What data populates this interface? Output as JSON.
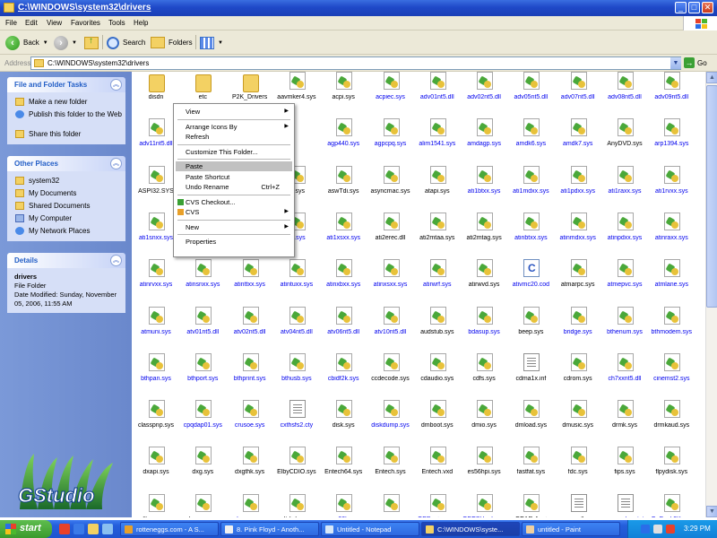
{
  "window": {
    "title": "C:\\WINDOWS\\system32\\drivers"
  },
  "menubar": [
    "File",
    "Edit",
    "View",
    "Favorites",
    "Tools",
    "Help"
  ],
  "toolbar": {
    "back_label": "Back",
    "search_label": "Search",
    "folders_label": "Folders"
  },
  "address": {
    "label": "Address",
    "path": "C:\\WINDOWS\\system32\\drivers",
    "go_label": "Go"
  },
  "taskpane": {
    "file_tasks": {
      "title": "File and Folder Tasks",
      "items": [
        "Make a new folder",
        "Publish this folder to the Web",
        "Share this folder"
      ]
    },
    "other_places": {
      "title": "Other Places",
      "items": [
        "system32",
        "My Documents",
        "Shared Documents",
        "My Computer",
        "My Network Places"
      ]
    },
    "details": {
      "title": "Details",
      "name": "drivers",
      "type": "File Folder",
      "modified": "Date Modified: Sunday, November 05, 2006, 11:55 AM"
    },
    "logo_text": "GStudio"
  },
  "files": [
    {
      "name": "disdn",
      "type": "folder",
      "color": "black"
    },
    {
      "name": "etc",
      "type": "folder",
      "color": "black"
    },
    {
      "name": "P2K_Drivers",
      "type": "folder",
      "color": "black"
    },
    {
      "name": "aavmker4.sys",
      "type": "sys",
      "color": "black"
    },
    {
      "name": "acpi.sys",
      "type": "sys",
      "color": "black"
    },
    {
      "name": "acpiec.sys",
      "type": "sys",
      "color": "blue"
    },
    {
      "name": "adv01nt5.dll",
      "type": "sys",
      "color": "blue"
    },
    {
      "name": "adv02nt5.dll",
      "type": "sys",
      "color": "blue"
    },
    {
      "name": "adv05nt5.dll",
      "type": "sys",
      "color": "blue"
    },
    {
      "name": "adv07nt5.dll",
      "type": "sys",
      "color": "blue"
    },
    {
      "name": "adv08nt5.dll",
      "type": "sys",
      "color": "blue"
    },
    {
      "name": "adv09nt5.dll",
      "type": "sys",
      "color": "blue"
    },
    {
      "name": "adv11nt5.dll",
      "type": "sys",
      "color": "blue"
    },
    {
      "name": "",
      "type": "none",
      "color": "blue"
    },
    {
      "name": "",
      "type": "none",
      "color": "blue"
    },
    {
      "name": "",
      "type": "none",
      "color": "blue"
    },
    {
      "name": "agp440.sys",
      "type": "sys",
      "color": "blue"
    },
    {
      "name": "agpcpq.sys",
      "type": "sys",
      "color": "blue"
    },
    {
      "name": "alim1541.sys",
      "type": "sys",
      "color": "blue"
    },
    {
      "name": "amdagp.sys",
      "type": "sys",
      "color": "blue"
    },
    {
      "name": "amdk6.sys",
      "type": "sys",
      "color": "blue"
    },
    {
      "name": "amdk7.sys",
      "type": "sys",
      "color": "blue"
    },
    {
      "name": "AnyDVD.sys",
      "type": "sys",
      "color": "black"
    },
    {
      "name": "arp1394.sys",
      "type": "sys",
      "color": "blue"
    },
    {
      "name": "ASPI32.SYS",
      "type": "sys",
      "color": "black"
    },
    {
      "name": "",
      "type": "none",
      "color": "black"
    },
    {
      "name": "",
      "type": "none",
      "color": "black"
    },
    {
      "name": "dr.sys",
      "type": "sys",
      "color": "black"
    },
    {
      "name": "aswTdi.sys",
      "type": "sys",
      "color": "black"
    },
    {
      "name": "asyncmac.sys",
      "type": "sys",
      "color": "black"
    },
    {
      "name": "atapi.sys",
      "type": "sys",
      "color": "black"
    },
    {
      "name": "ati1btxx.sys",
      "type": "sys",
      "color": "blue"
    },
    {
      "name": "ati1mdxx.sys",
      "type": "sys",
      "color": "blue"
    },
    {
      "name": "ati1pdxx.sys",
      "type": "sys",
      "color": "blue"
    },
    {
      "name": "ati1raxx.sys",
      "type": "sys",
      "color": "blue"
    },
    {
      "name": "ati1rvxx.sys",
      "type": "sys",
      "color": "blue"
    },
    {
      "name": "ati1snxx.sys",
      "type": "sys",
      "color": "blue"
    },
    {
      "name": "",
      "type": "none",
      "color": "blue"
    },
    {
      "name": "",
      "type": "none",
      "color": "blue"
    },
    {
      "name": "xx.sys",
      "type": "sys",
      "color": "blue"
    },
    {
      "name": "ati1xsxx.sys",
      "type": "sys",
      "color": "blue"
    },
    {
      "name": "ati2erec.dll",
      "type": "sys",
      "color": "black"
    },
    {
      "name": "ati2mtaa.sys",
      "type": "sys",
      "color": "black"
    },
    {
      "name": "ati2mtag.sys",
      "type": "sys",
      "color": "black"
    },
    {
      "name": "atinbtxx.sys",
      "type": "sys",
      "color": "blue"
    },
    {
      "name": "atinmdxx.sys",
      "type": "sys",
      "color": "blue"
    },
    {
      "name": "atinpdxx.sys",
      "type": "sys",
      "color": "blue"
    },
    {
      "name": "atinraxx.sys",
      "type": "sys",
      "color": "blue"
    },
    {
      "name": "atinrvxx.sys",
      "type": "sys",
      "color": "blue"
    },
    {
      "name": "atinsnxx.sys",
      "type": "sys",
      "color": "blue"
    },
    {
      "name": "atinttxx.sys",
      "type": "sys",
      "color": "blue"
    },
    {
      "name": "atintuxx.sys",
      "type": "sys",
      "color": "blue"
    },
    {
      "name": "atinxbxx.sys",
      "type": "sys",
      "color": "blue"
    },
    {
      "name": "atinxsxx.sys",
      "type": "sys",
      "color": "blue"
    },
    {
      "name": "atirwrf.sys",
      "type": "sys",
      "color": "blue"
    },
    {
      "name": "atirwvd.sys",
      "type": "sys",
      "color": "black"
    },
    {
      "name": "ativmc20.cod",
      "type": "c",
      "color": "blue"
    },
    {
      "name": "atmarpc.sys",
      "type": "sys",
      "color": "black"
    },
    {
      "name": "atmepvc.sys",
      "type": "sys",
      "color": "blue"
    },
    {
      "name": "atmlane.sys",
      "type": "sys",
      "color": "blue"
    },
    {
      "name": "atmuni.sys",
      "type": "sys",
      "color": "blue"
    },
    {
      "name": "atv01nt5.dll",
      "type": "sys",
      "color": "blue"
    },
    {
      "name": "atv02nt5.dll",
      "type": "sys",
      "color": "blue"
    },
    {
      "name": "atv04nt5.dll",
      "type": "sys",
      "color": "blue"
    },
    {
      "name": "atv06nt5.dll",
      "type": "sys",
      "color": "blue"
    },
    {
      "name": "atv10nt5.dll",
      "type": "sys",
      "color": "blue"
    },
    {
      "name": "audstub.sys",
      "type": "sys",
      "color": "black"
    },
    {
      "name": "bdasup.sys",
      "type": "sys",
      "color": "blue"
    },
    {
      "name": "beep.sys",
      "type": "sys",
      "color": "black"
    },
    {
      "name": "bridge.sys",
      "type": "sys",
      "color": "blue"
    },
    {
      "name": "bthenum.sys",
      "type": "sys",
      "color": "blue"
    },
    {
      "name": "bthmodem.sys",
      "type": "sys",
      "color": "blue"
    },
    {
      "name": "bthpan.sys",
      "type": "sys",
      "color": "blue"
    },
    {
      "name": "bthport.sys",
      "type": "sys",
      "color": "blue"
    },
    {
      "name": "bthprint.sys",
      "type": "sys",
      "color": "blue"
    },
    {
      "name": "bthusb.sys",
      "type": "sys",
      "color": "blue"
    },
    {
      "name": "cbidf2k.sys",
      "type": "sys",
      "color": "blue"
    },
    {
      "name": "ccdecode.sys",
      "type": "sys",
      "color": "black"
    },
    {
      "name": "cdaudio.sys",
      "type": "sys",
      "color": "black"
    },
    {
      "name": "cdfs.sys",
      "type": "sys",
      "color": "black"
    },
    {
      "name": "cdma1x.inf",
      "type": "inf",
      "color": "black"
    },
    {
      "name": "cdrom.sys",
      "type": "sys",
      "color": "black"
    },
    {
      "name": "ch7xxnt5.dll",
      "type": "sys",
      "color": "blue"
    },
    {
      "name": "cinemst2.sys",
      "type": "sys",
      "color": "blue"
    },
    {
      "name": "classpnp.sys",
      "type": "sys",
      "color": "black"
    },
    {
      "name": "cpqdap01.sys",
      "type": "sys",
      "color": "blue"
    },
    {
      "name": "crusoe.sys",
      "type": "sys",
      "color": "blue"
    },
    {
      "name": "cxthsfs2.cty",
      "type": "doc",
      "color": "blue"
    },
    {
      "name": "disk.sys",
      "type": "sys",
      "color": "black"
    },
    {
      "name": "diskdump.sys",
      "type": "sys",
      "color": "blue"
    },
    {
      "name": "dmboot.sys",
      "type": "sys",
      "color": "black"
    },
    {
      "name": "dmio.sys",
      "type": "sys",
      "color": "black"
    },
    {
      "name": "dmload.sys",
      "type": "sys",
      "color": "black"
    },
    {
      "name": "dmusic.sys",
      "type": "sys",
      "color": "black"
    },
    {
      "name": "drmk.sys",
      "type": "sys",
      "color": "black"
    },
    {
      "name": "drmkaud.sys",
      "type": "sys",
      "color": "black"
    },
    {
      "name": "dxapi.sys",
      "type": "sys",
      "color": "black"
    },
    {
      "name": "dxg.sys",
      "type": "sys",
      "color": "black"
    },
    {
      "name": "dxgthk.sys",
      "type": "sys",
      "color": "black"
    },
    {
      "name": "ElbyCDIO.sys",
      "type": "sys",
      "color": "black"
    },
    {
      "name": "Entech64.sys",
      "type": "sys",
      "color": "black"
    },
    {
      "name": "Entech.sys",
      "type": "sys",
      "color": "black"
    },
    {
      "name": "Entech.vxd",
      "type": "sys",
      "color": "black"
    },
    {
      "name": "es56hpi.sys",
      "type": "sys",
      "color": "black"
    },
    {
      "name": "fastfat.sys",
      "type": "sys",
      "color": "black"
    },
    {
      "name": "fdc.sys",
      "type": "sys",
      "color": "black"
    },
    {
      "name": "fips.sys",
      "type": "sys",
      "color": "black"
    },
    {
      "name": "flpydisk.sys",
      "type": "sys",
      "color": "black"
    },
    {
      "name": "fltmgr.sys",
      "type": "sys",
      "color": "black"
    },
    {
      "name": "fs_rec.sys",
      "type": "sys",
      "color": "black"
    },
    {
      "name": "fsvga.sys",
      "type": "sys",
      "color": "blue"
    },
    {
      "name": "ftdisk.sys",
      "type": "sys",
      "color": "black"
    },
    {
      "name": "gagp30kx.sys",
      "type": "sys",
      "color": "blue"
    },
    {
      "name": "gameenum.sys",
      "type": "sys",
      "color": "black"
    },
    {
      "name": "GBDevice.sys",
      "type": "sys",
      "color": "blue"
    },
    {
      "name": "GBESHook.sys",
      "type": "sys",
      "color": "blue"
    },
    {
      "name": "GEAR.Aspi",
      "type": "sys",
      "color": "black"
    },
    {
      "name": "gm.dls",
      "type": "doc",
      "color": "black"
    },
    {
      "name": "gmreadme.txt",
      "type": "doc",
      "color": "blue"
    },
    {
      "name": "GoBack2K.sys",
      "type": "sys",
      "color": "blue"
    }
  ],
  "context_menu": {
    "items": [
      {
        "label": "View",
        "submenu": true
      },
      {
        "sep": true
      },
      {
        "label": "Arrange Icons By",
        "submenu": true
      },
      {
        "label": "Refresh"
      },
      {
        "sep": true
      },
      {
        "label": "Customize This Folder..."
      },
      {
        "sep": true
      },
      {
        "label": "Paste",
        "highlight": true
      },
      {
        "label": "Paste Shortcut"
      },
      {
        "label": "Undo Rename",
        "shortcut": "Ctrl+Z"
      },
      {
        "sep": true
      },
      {
        "label": "CVS Checkout...",
        "icon": true
      },
      {
        "label": "CVS",
        "submenu": true,
        "icon": true
      },
      {
        "sep": true
      },
      {
        "label": "New",
        "submenu": true
      },
      {
        "sep": true
      },
      {
        "label": "Properties"
      }
    ]
  },
  "taskbar": {
    "start_label": "start",
    "items": [
      {
        "label": "rotteneggs.com - A S..."
      },
      {
        "label": "8. Pink Floyd - Anoth..."
      },
      {
        "label": "Untitled - Notepad"
      },
      {
        "label": "C:\\WINDOWS\\syste...",
        "active": true
      },
      {
        "label": "untitled - Paint"
      }
    ],
    "clock": "3:29 PM"
  }
}
